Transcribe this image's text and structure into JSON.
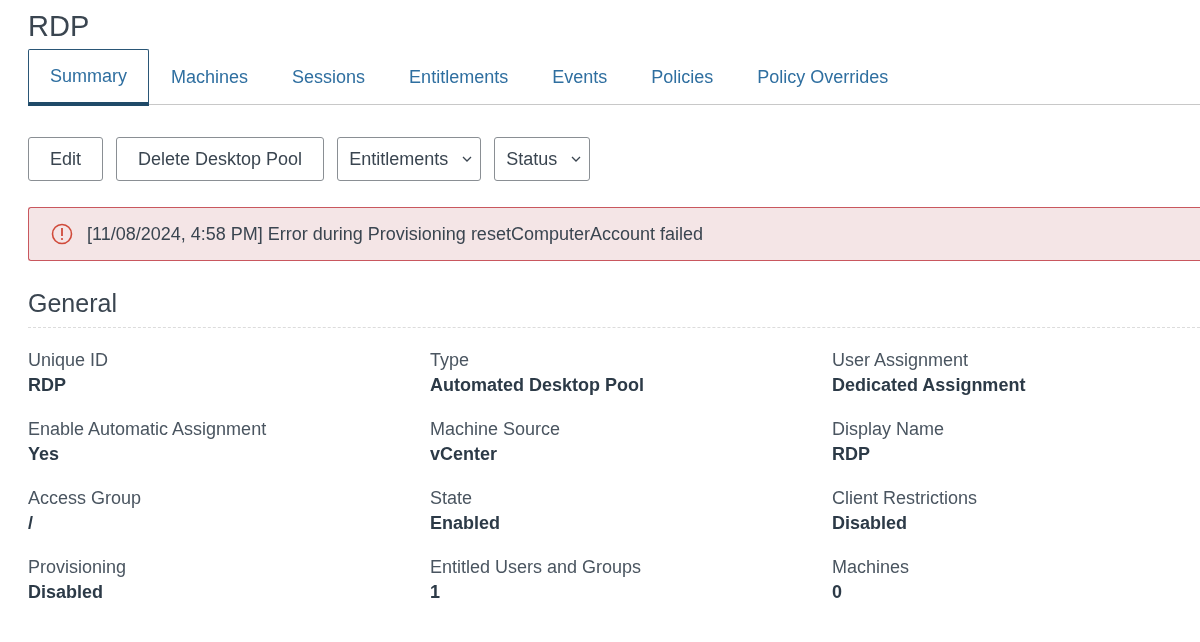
{
  "page": {
    "title": "RDP"
  },
  "tabs": [
    {
      "label": "Summary",
      "selected": true
    },
    {
      "label": "Machines",
      "selected": false
    },
    {
      "label": "Sessions",
      "selected": false
    },
    {
      "label": "Entitlements",
      "selected": false
    },
    {
      "label": "Events",
      "selected": false
    },
    {
      "label": "Policies",
      "selected": false
    },
    {
      "label": "Policy Overrides",
      "selected": false
    }
  ],
  "toolbar": [
    {
      "label": "Edit",
      "kind": "button"
    },
    {
      "label": "Delete Desktop Pool",
      "kind": "button"
    },
    {
      "label": "Entitlements",
      "kind": "dropdown"
    },
    {
      "label": "Status",
      "kind": "dropdown"
    }
  ],
  "alert": {
    "kind": "error",
    "message": "[11/08/2024, 4:58 PM] Error during Provisioning resetComputerAccount failed"
  },
  "section": {
    "title": "General",
    "fields": [
      {
        "label": "Unique ID",
        "value": "RDP"
      },
      {
        "label": "Type",
        "value": "Automated Desktop Pool"
      },
      {
        "label": "User Assignment",
        "value": "Dedicated Assignment"
      },
      {
        "label": "Enable Automatic Assignment",
        "value": "Yes"
      },
      {
        "label": "Machine Source",
        "value": "vCenter"
      },
      {
        "label": "Display Name",
        "value": "RDP"
      },
      {
        "label": "Access Group",
        "value": "/"
      },
      {
        "label": "State",
        "value": "Enabled"
      },
      {
        "label": "Client Restrictions",
        "value": "Disabled"
      },
      {
        "label": "Provisioning",
        "value": "Disabled"
      },
      {
        "label": "Entitled Users and Groups",
        "value": "1"
      },
      {
        "label": "Machines",
        "value": "0"
      }
    ]
  }
}
